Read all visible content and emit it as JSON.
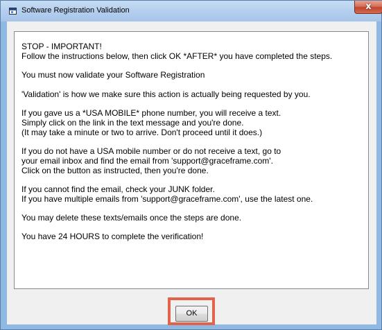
{
  "window": {
    "title": "Software Registration Validation",
    "close_glyph": "x"
  },
  "message": {
    "paragraphs": [
      {
        "lines": [
          "STOP - IMPORTANT!",
          "Follow the instructions below, then click OK *AFTER* you have completed the steps."
        ]
      },
      {
        "lines": [
          "You must now validate your Software Registration"
        ]
      },
      {
        "lines": [
          "'Validation' is how we make sure this action is actually being requested by you."
        ]
      },
      {
        "lines": [
          "If you gave us a *USA MOBILE* phone number, you will receive a text.",
          "Simply click on the link in the text message and you're done.",
          "(It may take a minute or two to arrive. Don't proceed until it does.)"
        ]
      },
      {
        "lines": [
          "If you do not have a USA mobile number or do not receive a text, go to",
          "your email inbox and find the email from 'support@graceframe.com'.",
          "Click on the button as instructed, then you're done."
        ]
      },
      {
        "lines": [
          "If you cannot find the email, check your JUNK folder.",
          "If you have multiple emails from 'support@graceframe.com', use the latest one."
        ]
      },
      {
        "lines": [
          "You may delete these texts/emails once the steps are done."
        ]
      },
      {
        "lines": [
          "You have 24 HOURS to complete the verification!"
        ]
      }
    ]
  },
  "buttons": {
    "ok_label": "OK"
  },
  "colors": {
    "highlight": "#e0634a",
    "titlebar": "#b4cfee",
    "close_button": "#c7503a"
  },
  "icons": {
    "app": "window-app-icon",
    "close": "close-icon"
  }
}
